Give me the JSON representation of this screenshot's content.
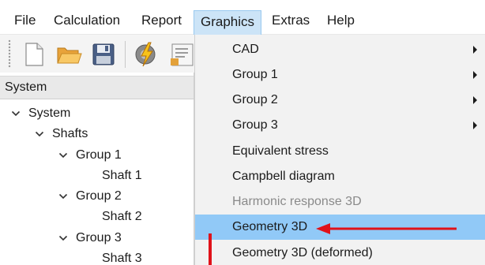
{
  "menubar": {
    "items": [
      {
        "label": "File"
      },
      {
        "label": "Calculation"
      },
      {
        "label": "Report"
      },
      {
        "label": "Graphics"
      },
      {
        "label": "Extras"
      },
      {
        "label": "Help"
      }
    ],
    "active_index": 3
  },
  "toolbar": {
    "buttons": [
      {
        "icon": "new-file-icon"
      },
      {
        "icon": "open-folder-icon"
      },
      {
        "icon": "save-icon"
      },
      {
        "icon": "run-calculation-icon"
      },
      {
        "icon": "report-icon"
      }
    ]
  },
  "system_panel": {
    "title": "System",
    "tree": [
      {
        "label": "System",
        "level": 0,
        "expanded": true
      },
      {
        "label": "Shafts",
        "level": 1,
        "expanded": true
      },
      {
        "label": "Group 1",
        "level": 2,
        "expanded": true
      },
      {
        "label": "Shaft 1",
        "level": 3
      },
      {
        "label": "Group 2",
        "level": 2,
        "expanded": true
      },
      {
        "label": "Shaft 2",
        "level": 3
      },
      {
        "label": "Group 3",
        "level": 2,
        "expanded": true
      },
      {
        "label": "Shaft 3",
        "level": 3
      }
    ]
  },
  "graphics_menu": {
    "items": [
      {
        "label": "CAD",
        "submenu": true
      },
      {
        "label": "Group 1",
        "submenu": true
      },
      {
        "label": "Group 2",
        "submenu": true
      },
      {
        "label": "Group 3",
        "submenu": true
      },
      {
        "label": "Equivalent stress"
      },
      {
        "label": "Campbell diagram"
      },
      {
        "label": "Harmonic response 3D",
        "disabled": true
      },
      {
        "label": "Geometry 3D",
        "highlighted": true
      },
      {
        "label": "Geometry 3D (deformed)"
      }
    ]
  },
  "colors": {
    "menu_active_bg": "#cce4f7",
    "highlight_bg": "#91c9f7",
    "annotation_red": "#e0121a"
  }
}
